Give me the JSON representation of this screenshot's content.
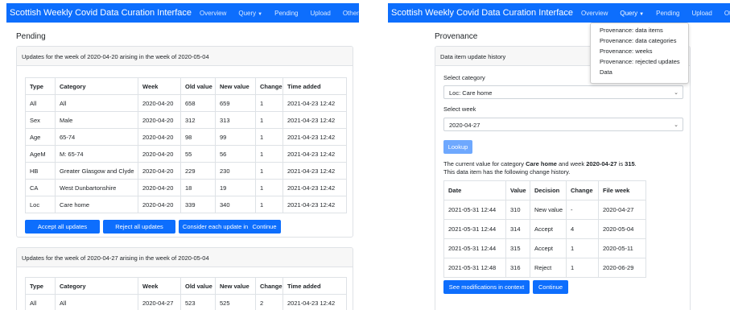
{
  "navbar": {
    "brand": "Scottish Weekly Covid Data Curation Interface",
    "overview": "Overview",
    "query": "Query",
    "pending": "Pending",
    "upload": "Upload",
    "other": "Other"
  },
  "query_menu": {
    "items": [
      "Provenance: data items",
      "Provenance: data categories",
      "Provenance: weeks",
      "Provenance: rejected updates",
      "Data"
    ]
  },
  "pending": {
    "title": "Pending",
    "columns": [
      "Type",
      "Category",
      "Week",
      "Old value",
      "New value",
      "Change",
      "Time added"
    ],
    "cards": [
      {
        "header": "Updates for the week of 2020-04-20 arising in the week of 2020-05-04",
        "rows": [
          [
            "All",
            "All",
            "2020-04-20",
            "658",
            "659",
            "1",
            "2021-04-23 12:42"
          ],
          [
            "Sex",
            "Male",
            "2020-04-20",
            "312",
            "313",
            "1",
            "2021-04-23 12:42"
          ],
          [
            "Age",
            "65-74",
            "2020-04-20",
            "98",
            "99",
            "1",
            "2021-04-23 12:42"
          ],
          [
            "AgeM",
            "M: 65-74",
            "2020-04-20",
            "55",
            "56",
            "1",
            "2021-04-23 12:42"
          ],
          [
            "HB",
            "Greater Glasgow and Clyde",
            "2020-04-20",
            "229",
            "230",
            "1",
            "2021-04-23 12:42"
          ],
          [
            "CA",
            "West Dunbartonshire",
            "2020-04-20",
            "18",
            "19",
            "1",
            "2021-04-23 12:42"
          ],
          [
            "Loc",
            "Care home",
            "2020-04-20",
            "339",
            "340",
            "1",
            "2021-04-23 12:42"
          ]
        ]
      },
      {
        "header": "Updates for the week of 2020-04-27 arising in the week of 2020-05-04",
        "rows": [
          [
            "All",
            "All",
            "2020-04-27",
            "523",
            "525",
            "2",
            "2021-04-23 12:42"
          ]
        ]
      }
    ],
    "buttons": {
      "accept_all": "Accept all updates",
      "reject_all": "Reject all updates",
      "individually": "Consider each update individually",
      "continue": "Continue"
    }
  },
  "provenance": {
    "title": "Provenance",
    "card_header": "Data item update history",
    "category_label": "Select category",
    "category_value": "Loc: Care home",
    "week_label": "Select week",
    "week_value": "2020-04-27",
    "lookup": "Lookup",
    "result": {
      "t1": "The current value for category ",
      "category": "Care home",
      "t2": " and week ",
      "week": "2020-04-27",
      "t3": " is ",
      "value": "315",
      "t4": ".",
      "line2": "This data item has the following change history."
    },
    "history_columns": [
      "Date",
      "Value",
      "Decision",
      "Change",
      "File week"
    ],
    "history_rows": [
      [
        "2021-05-31 12:44",
        "310",
        "New value",
        "-",
        "2020-04-27"
      ],
      [
        "2021-05-31 12:44",
        "314",
        "Accept",
        "4",
        "2020-05-04"
      ],
      [
        "2021-05-31 12:44",
        "315",
        "Accept",
        "1",
        "2020-05-11"
      ],
      [
        "2021-05-31 12:48",
        "316",
        "Reject",
        "1",
        "2020-06-29"
      ]
    ],
    "see_modifications": "See modifications in context",
    "continue": "Continue"
  },
  "colors": {
    "primary": "#0d6efd",
    "primary_disabled": "#6ea8fe",
    "card_header_bg": "#f7f7f7",
    "border": "#dee2e6"
  },
  "icons": {
    "dropdown_caret": "caret-down-icon",
    "select_caret": "chevron-down-icon"
  }
}
